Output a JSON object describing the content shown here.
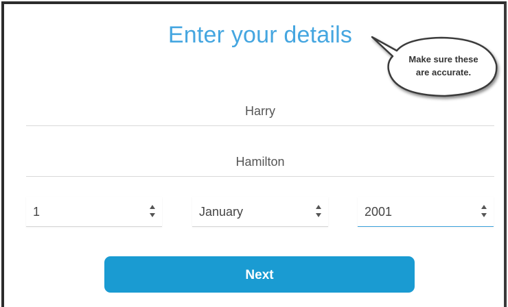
{
  "form": {
    "title": "Enter your details",
    "first_name": "Harry",
    "last_name": "Hamilton",
    "dob": {
      "day": "1",
      "month": "January",
      "year": "2001"
    },
    "next_label": "Next"
  },
  "callout": {
    "line1": "Make sure these",
    "line2": "are accurate."
  },
  "colors": {
    "title": "#45a6e0",
    "button": "#1a9bd2",
    "active_underline": "#3aa0db"
  }
}
